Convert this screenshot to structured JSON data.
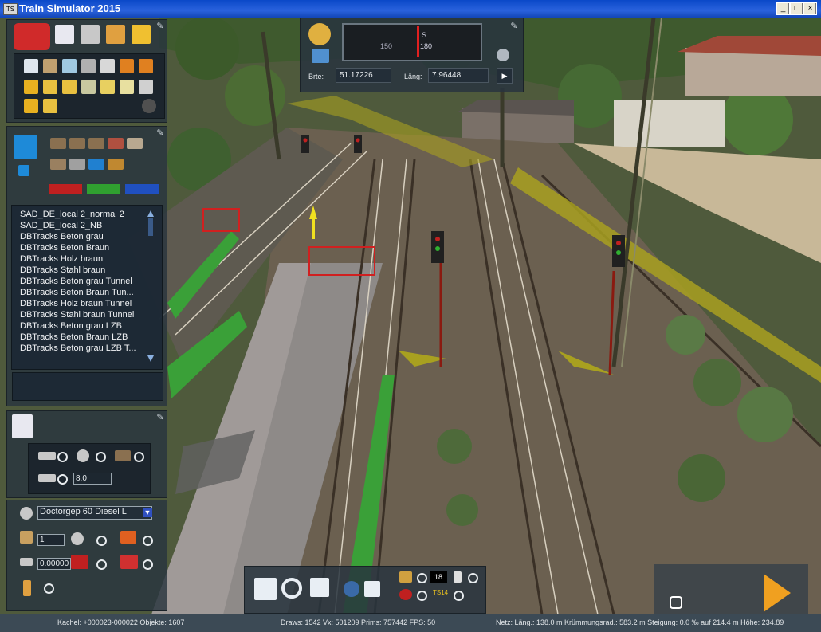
{
  "window": {
    "title": "Train Simulator 2015",
    "app_icon_text": "TS",
    "min_label": "_",
    "max_label": "□",
    "close_label": "×"
  },
  "compass": {
    "lat_label": "Brte:",
    "lat_value": "51.17226",
    "lon_label": "Läng:",
    "lon_value": "7.96448",
    "scale_left": "150",
    "scale_right": "180",
    "heading_letter": "S"
  },
  "left_panel": {
    "track_list": [
      "SAD_DE_local 2_normal 2",
      "SAD_DE_local 2_NB",
      "DBTracks Beton grau",
      "DBTracks Beton Braun",
      "DBTracks Holz braun",
      "DBTracks Stahl braun",
      "DBTracks Beton grau Tunnel",
      "DBTracks Beton Braun Tun...",
      "DBTracks Holz braun Tunnel",
      "DBTracks Stahl braun Tunnel",
      "DBTracks Beton grau LZB",
      "DBTracks Beton Braun LZB",
      "DBTracks Beton grau LZB T..."
    ],
    "width_field": "8.0",
    "route_select": "Doctorgep 60 Diesel L",
    "count_field": "1",
    "gradient_field": "0.00000"
  },
  "bottom_toolbar": {
    "counter_value": "18",
    "ts_label": "TS14"
  },
  "status": {
    "tile": "Kachel: +000023-000022  Objekte: 1607",
    "draws": "Draws: 1542 Vx: 501209 Prims: 757442 FPS: 50",
    "net": "Netz:  Läng.:  138.0 m  Krümmungsrad.: 583.2 m  Steigung:  0.0 ‰ auf 214.4 m  Höhe:  234.89"
  },
  "colors": {
    "title_bar": "#0a48c8",
    "panel_bg": "#28343e",
    "track_green": "#3aa038",
    "track_yellow": "#a8a020",
    "signal_red": "#c02020"
  }
}
